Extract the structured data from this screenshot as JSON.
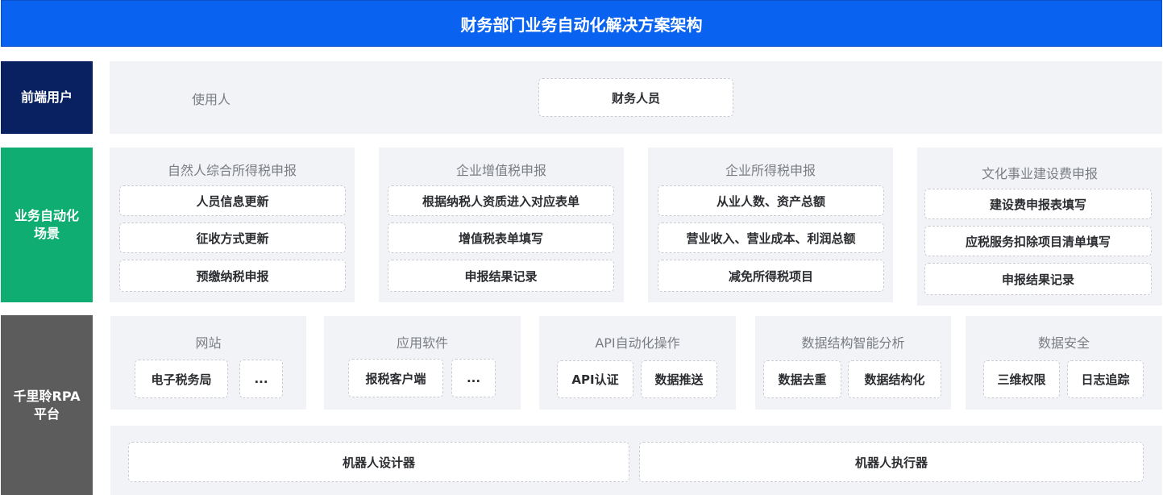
{
  "title": "财务部门业务自动化解决方案架构",
  "colors": {
    "title_bg": "#0a63f0",
    "frontend_bg": "#0a2161",
    "automation_bg": "#0fad72",
    "platform_bg": "#5c5c5c",
    "panel_bg": "#f1f3f7"
  },
  "frontend": {
    "label": "前端用户",
    "user_label": "使用人",
    "user": "财务人员"
  },
  "automation": {
    "label": "业务自动化场景",
    "groups": [
      {
        "title": "自然人综合所得税申报",
        "items": [
          "人员信息更新",
          "征收方式更新",
          "预缴纳税申报"
        ]
      },
      {
        "title": "企业增值税申报",
        "items": [
          "根据纳税人资质进入对应表单",
          "增值税表单填写",
          "申报结果记录"
        ]
      },
      {
        "title": "企业所得税申报",
        "items": [
          "从业人数、资产总额",
          "营业收入、营业成本、利润总额",
          "减免所得税项目"
        ]
      },
      {
        "title": "文化事业建设费申报",
        "items": [
          "建设费申报表填写",
          "应税服务扣除项目清单填写",
          "申报结果记录"
        ]
      }
    ]
  },
  "platform": {
    "label": "千里聆RPA平台",
    "groups": [
      {
        "title": "网站",
        "items": [
          "电子税务局",
          "..."
        ]
      },
      {
        "title": "应用软件",
        "items": [
          "报税客户端",
          "..."
        ]
      },
      {
        "title": "API自动化操作",
        "items": [
          "API认证",
          "数据推送"
        ]
      },
      {
        "title": "数据结构智能分析",
        "items": [
          "数据去重",
          "数据结构化"
        ]
      },
      {
        "title": "数据安全",
        "items": [
          "三维权限",
          "日志追踪"
        ]
      }
    ],
    "tools": [
      "机器人设计器",
      "机器人执行器"
    ]
  }
}
